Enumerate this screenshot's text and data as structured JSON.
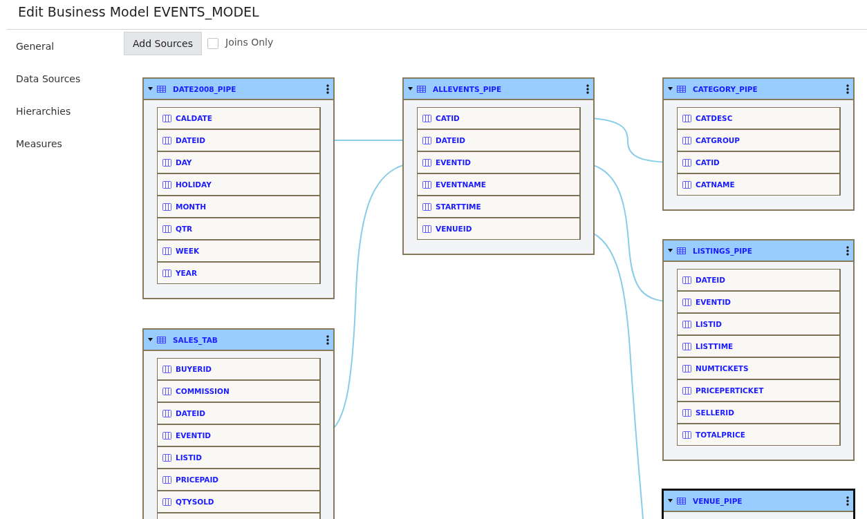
{
  "title": "Edit Business Model EVENTS_MODEL",
  "nav": [
    {
      "label": "General"
    },
    {
      "label": "Data Sources"
    },
    {
      "label": "Hierarchies"
    },
    {
      "label": "Measures"
    }
  ],
  "toolbar": {
    "button": "Add Sources",
    "checkbox": {
      "label": "Joins Only",
      "checked": false
    }
  },
  "tables": [
    {
      "name": "DATE2008_PIPE",
      "selected": false,
      "columns": [
        "CALDATE",
        "DATEID",
        "DAY",
        "HOLIDAY",
        "MONTH",
        "QTR",
        "WEEK",
        "YEAR"
      ]
    },
    {
      "name": "ALLEVENTS_PIPE",
      "selected": false,
      "columns": [
        "CATID",
        "DATEID",
        "EVENTID",
        "EVENTNAME",
        "STARTTIME",
        "VENUEID"
      ]
    },
    {
      "name": "CATEGORY_PIPE",
      "selected": false,
      "columns": [
        "CATDESC",
        "CATGROUP",
        "CATID",
        "CATNAME"
      ]
    },
    {
      "name": "LISTINGS_PIPE",
      "selected": false,
      "columns": [
        "DATEID",
        "EVENTID",
        "LISTID",
        "LISTTIME",
        "NUMTICKETS",
        "PRICEPERTICKET",
        "SELLERID",
        "TOTALPRICE"
      ]
    },
    {
      "name": "SALES_TAB",
      "selected": false,
      "columns": [
        "BUYERID",
        "COMMISSION",
        "DATEID",
        "EVENTID",
        "LISTID",
        "PRICEPAID",
        "QTYSOLD"
      ]
    },
    {
      "name": "VENUE_PIPE",
      "selected": true
    }
  ]
}
